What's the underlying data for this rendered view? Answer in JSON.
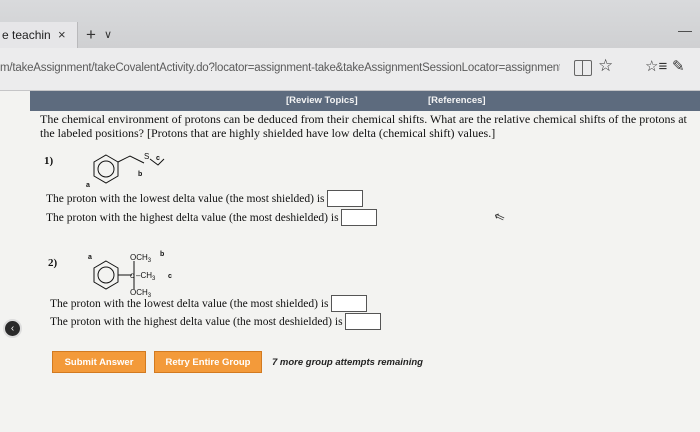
{
  "browser": {
    "tab_title": "e teachin",
    "tab_close": "×",
    "new_tab": "+",
    "tab_menu": "∨",
    "url": "m/takeAssignment/takeCovalentActivity.do?locator=assignment-take&takeAssignmentSessionLocator=assignment-take",
    "icons": [
      "reading-view-icon",
      "favorite-star-icon",
      "hub-icon",
      "web-note-pen-icon"
    ]
  },
  "links": {
    "review_topics": "[Review Topics]",
    "references": "[References]"
  },
  "question": {
    "prompt": "The chemical environment of protons can be deduced from their chemical shifts. What are the relative chemical shifts of the protons at the labeled positions? [Protons that are highly shielded have low delta (chemical shift) values.]"
  },
  "parts": [
    {
      "number": "1)",
      "labels": {
        "a": "a",
        "b": "b",
        "c": "c",
        "S": "S"
      },
      "lowest_prompt": "The proton with the lowest delta value (the most shielded) is",
      "highest_prompt": "The proton with the highest delta value (the most deshielded) is",
      "lowest_value": "",
      "highest_value": ""
    },
    {
      "number": "2)",
      "labels": {
        "a": "a",
        "b": "b",
        "c": "c",
        "top": "OCH",
        "top_sub": "3",
        "mid": "–CH",
        "mid_sub": "3",
        "bottom": "OCH",
        "bottom_sub": "3",
        "C": "C"
      },
      "lowest_prompt": "The proton with the lowest delta value (the most shielded) is",
      "highest_prompt": "The proton with the highest delta value (the most deshielded) is",
      "lowest_value": "",
      "highest_value": ""
    }
  ],
  "actions": {
    "submit": "Submit Answer",
    "retry": "Retry Entire Group",
    "remaining": "7 more group attempts remaining"
  },
  "colors": {
    "button": "#f39a3a",
    "topics_bar": "#5d6b7e",
    "page_bg": "#f3f3f1"
  }
}
